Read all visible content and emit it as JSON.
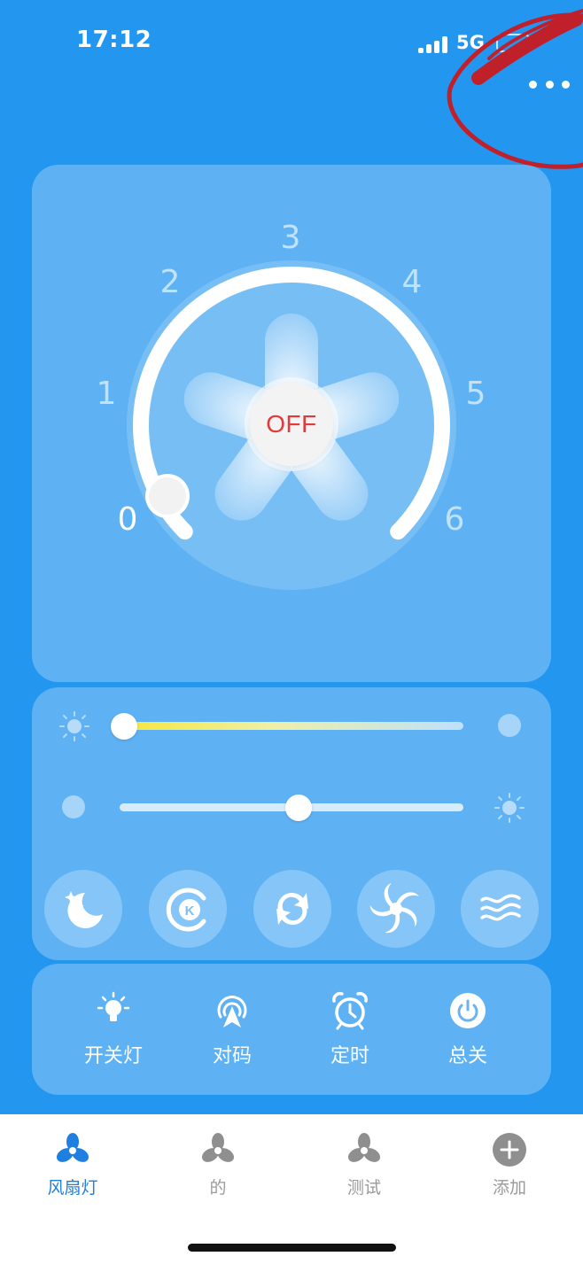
{
  "status_bar": {
    "time": "17:12",
    "network": "5G"
  },
  "dial": {
    "speed_labels": [
      "0",
      "1",
      "2",
      "3",
      "4",
      "5",
      "6"
    ],
    "current_speed": 0,
    "power_label": "OFF"
  },
  "sliders": {
    "color_temperature": {
      "value": 0.0
    },
    "brightness": {
      "value": 0.52
    }
  },
  "modes": [
    {
      "icon": "moon-stars-icon"
    },
    {
      "icon": "kelvin-icon"
    },
    {
      "icon": "refresh-icon"
    },
    {
      "icon": "swirl-fan-icon"
    },
    {
      "icon": "natural-wind-icon"
    }
  ],
  "actions": [
    {
      "label": "开关灯",
      "icon": "bulb-icon"
    },
    {
      "label": "对码",
      "icon": "pairing-icon"
    },
    {
      "label": "定时",
      "icon": "alarm-clock-icon"
    },
    {
      "label": "总关",
      "icon": "power-icon"
    }
  ],
  "tabs": [
    {
      "label": "风扇灯",
      "icon": "fan-icon",
      "active": true
    },
    {
      "label": "的",
      "icon": "fan-icon",
      "active": false
    },
    {
      "label": "测试",
      "icon": "fan-icon",
      "active": false
    },
    {
      "label": "添加",
      "icon": "add-icon",
      "active": false
    }
  ],
  "colors": {
    "background": "#2396F0",
    "off_text": "#E03A3A",
    "active_tab": "#1E7FE0",
    "annotation": "#C0202A"
  }
}
